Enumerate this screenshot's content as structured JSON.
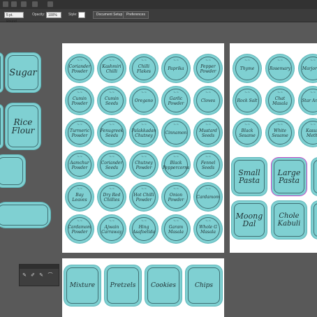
{
  "toolbar": {
    "stroke_value": "5 pt. Round",
    "opacity_label": "Opacity:",
    "opacity_value": "100%",
    "style_label": "Style:",
    "document_setup": "Document Setup",
    "preferences": "Preferences"
  },
  "left_labels": {
    "sugar": "Sugar",
    "rice_flour_1": "Rice",
    "rice_flour_2": "Flour"
  },
  "spice_grid": [
    [
      "Coriander Powder",
      "Kashmiri Chilli",
      "Chilli Flakes",
      "Paprika",
      "Pepper Powder"
    ],
    [
      "Cumin Powder",
      "Cumin Seeds",
      "Oregano",
      "Garlic Powder",
      "Cloves"
    ],
    [
      "Turmeric Powder",
      "Fenugreek Seeds",
      "Palakkadan Chutney",
      "Cinnamon",
      "Mustard Seeds"
    ],
    [
      "Aamchur Powder",
      "Coriander Seeds",
      "Chutney Powder",
      "Black Peppercorns",
      "Fennel Seeds"
    ],
    [
      "Bay Leaves",
      "Dry Red Chillies",
      "Hot Chilli Powder",
      "Onion Powder",
      "Cardamom"
    ],
    [
      "Cardamom Powder",
      "Ajwain Carraway",
      "Hing Asafoetida",
      "Garam Masala",
      "Whole G Masala"
    ]
  ],
  "right_grid": [
    [
      "Thyme",
      "Rosemary",
      "Marjoram"
    ],
    [
      "Rock Salt",
      "Chat Masala",
      "Star Anise"
    ],
    [
      "Black Sesame",
      "White Sesame",
      "Kasuri Methi"
    ]
  ],
  "pasta_labels": {
    "small_pasta_1": "Small",
    "small_pasta_2": "Pasta",
    "large_pasta_1": "Large",
    "large_pasta_2": "Pasta",
    "moong_dal_1": "Moong",
    "moong_dal_2": "Dal",
    "chole_kabuli_1": "Chole",
    "chole_kabuli_2": "Kabuli"
  },
  "snack_labels": [
    "Mixture",
    "Pretzels",
    "Cookies",
    "Chips"
  ],
  "colors": {
    "label_fill": "#7fd0d2",
    "label_text": "#1e2e30",
    "app_background": "#535353"
  }
}
